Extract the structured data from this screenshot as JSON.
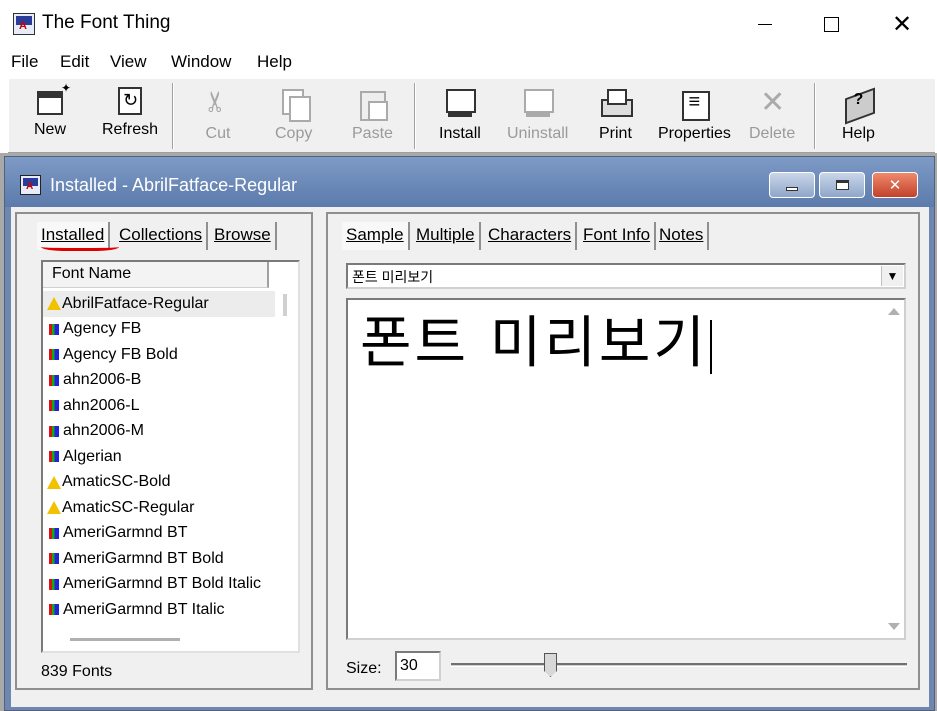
{
  "window": {
    "title": "The Font Thing",
    "minimize": "",
    "maximize": "",
    "close": "✕"
  },
  "menu": [
    "File",
    "Edit",
    "View",
    "Window",
    "Help"
  ],
  "toolbar": {
    "new": "New",
    "refresh": "Refresh",
    "cut": "Cut",
    "copy": "Copy",
    "paste": "Paste",
    "install": "Install",
    "uninstall": "Uninstall",
    "print": "Print",
    "properties": "Properties",
    "delete": "Delete",
    "help": "Help"
  },
  "child": {
    "title": "Installed - AbrilFatface-Regular",
    "close": "✕"
  },
  "left_tabs": [
    "Installed",
    "Collections",
    "Browse"
  ],
  "font_list": {
    "header": "Font Name",
    "rows": [
      {
        "name": "AbrilFatface-Regular",
        "icon": "warning-icon"
      },
      {
        "name": "Agency FB",
        "icon": "truetype-icon"
      },
      {
        "name": "Agency FB Bold",
        "icon": "truetype-icon"
      },
      {
        "name": "ahn2006-B",
        "icon": "truetype-icon"
      },
      {
        "name": "ahn2006-L",
        "icon": "truetype-icon"
      },
      {
        "name": "ahn2006-M",
        "icon": "truetype-icon"
      },
      {
        "name": "Algerian",
        "icon": "truetype-icon"
      },
      {
        "name": "AmaticSC-Bold",
        "icon": "warning-icon"
      },
      {
        "name": "AmaticSC-Regular",
        "icon": "warning-icon"
      },
      {
        "name": "AmeriGarmnd BT",
        "icon": "truetype-icon"
      },
      {
        "name": "AmeriGarmnd BT Bold",
        "icon": "truetype-icon"
      },
      {
        "name": "AmeriGarmnd BT Bold Italic",
        "icon": "truetype-icon"
      },
      {
        "name": "AmeriGarmnd BT Italic",
        "icon": "truetype-icon"
      }
    ],
    "count": "839 Fonts"
  },
  "right_tabs": [
    "Sample",
    "Multiple",
    "Characters",
    "Font Info",
    "Notes"
  ],
  "sample": {
    "select_value": "폰트 미리보기",
    "preview_text": "폰트 미리보기",
    "size_label": "Size:",
    "size_value": "30"
  },
  "colors": {
    "child_title": "#6e87b1",
    "highlight_mark": "#e00000"
  }
}
